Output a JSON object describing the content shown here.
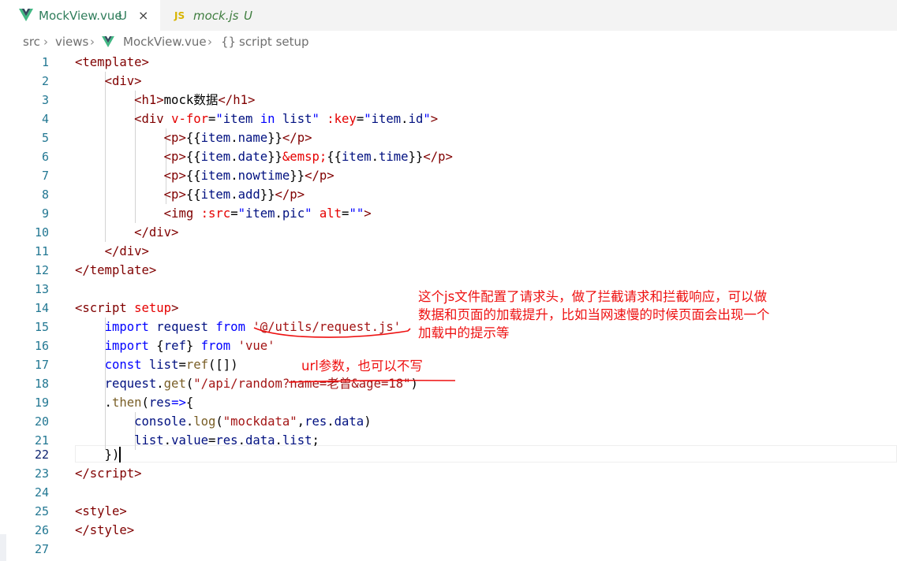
{
  "tabs": [
    {
      "label": "MockView.vue",
      "status": "U",
      "close": "×",
      "icon": "vue-icon"
    },
    {
      "label": "mock.js",
      "status": "U",
      "icon": "js-icon",
      "icon_text": "JS"
    }
  ],
  "breadcrumb": {
    "items": [
      "src",
      "views",
      "MockView.vue",
      "script setup"
    ],
    "symbol_icon_text": "{}"
  },
  "editor": {
    "line_numbers": [
      "1",
      "2",
      "3",
      "4",
      "5",
      "6",
      "7",
      "8",
      "9",
      "10",
      "11",
      "12",
      "13",
      "14",
      "15",
      "16",
      "17",
      "18",
      "19",
      "20",
      "21",
      "22",
      "23",
      "24",
      "25",
      "26",
      "27"
    ],
    "active_line": "22"
  },
  "annotations": {
    "note1": [
      "这个js文件配置了请求头，做了拦截请求和拦截响应，可以做",
      "数据和页面的加载提升，比如当网速慢的时候页面会出现一个",
      "加载中的提示等"
    ],
    "note2": "url参数，也可以不写"
  },
  "colors": {
    "annotation": "#ee1111",
    "vue_green": "#41b883",
    "vue_dark": "#35495e",
    "js_yellow": "#d8b400"
  }
}
